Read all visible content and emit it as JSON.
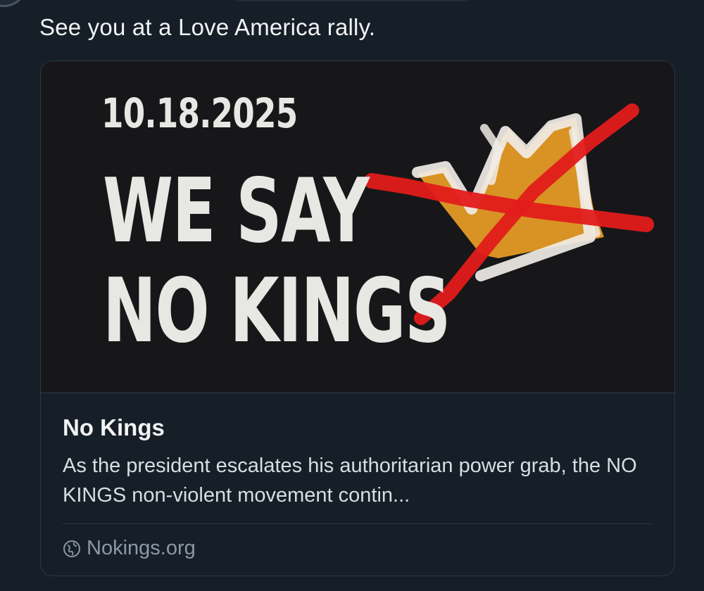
{
  "post": {
    "text": "See you at a Love America rally."
  },
  "link_card": {
    "image": {
      "date": "10.18.2025",
      "headline_line1": "WE SAY",
      "headline_line2": "NO KINGS",
      "icon": "crossed-out-crown"
    },
    "title": "No Kings",
    "description": "As the president escalates his authoritarian power grab, the NO KINGS non-violent movement contin...",
    "source_icon": "globe-icon",
    "source": "Nokings.org"
  },
  "colors": {
    "background": "#161e27",
    "card_border": "#2c3845",
    "text_primary": "#f1f3f5",
    "text_secondary": "#d7dde3",
    "text_muted": "#8b98a7",
    "banner_background": "#141416",
    "banner_text": "#e7e7e4",
    "crown_fill": "#e39a25",
    "strike_red": "#e21b1b"
  }
}
